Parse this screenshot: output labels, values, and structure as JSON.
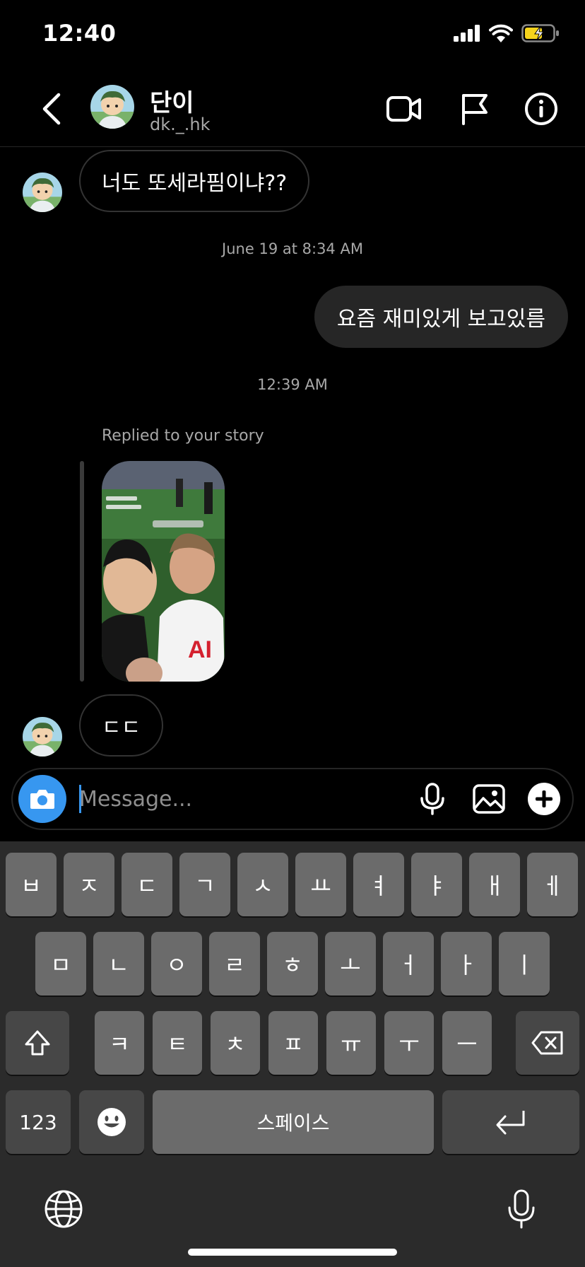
{
  "status_bar": {
    "time": "12:40"
  },
  "header": {
    "name": "단이",
    "handle": "dk._.hk"
  },
  "messages": {
    "incoming_1": "너도 또세라핌이냐??",
    "timestamp_1": "June 19 at 8:34 AM",
    "outgoing_1": "요즘 재미있게 보고있름",
    "timestamp_2": "12:39 AM",
    "reply_label": "Replied to your story",
    "incoming_2": "ㄷㄷ"
  },
  "composer": {
    "placeholder": "Message..."
  },
  "keyboard": {
    "row1": [
      "ㅂ",
      "ㅈ",
      "ㄷ",
      "ㄱ",
      "ㅅ",
      "ㅛ",
      "ㅕ",
      "ㅑ",
      "ㅐ",
      "ㅔ"
    ],
    "row2": [
      "ㅁ",
      "ㄴ",
      "ㅇ",
      "ㄹ",
      "ㅎ",
      "ㅗ",
      "ㅓ",
      "ㅏ",
      "ㅣ"
    ],
    "row3": [
      "ㅋ",
      "ㅌ",
      "ㅊ",
      "ㅍ",
      "ㅠ",
      "ㅜ",
      "ㅡ"
    ],
    "numbers_label": "123",
    "space_label": "스페이스"
  },
  "colors": {
    "accent": "#3797f0",
    "background": "#000000",
    "bubble_out": "#262626",
    "keyboard": "#2b2b2b",
    "key": "#6b6b6b"
  }
}
